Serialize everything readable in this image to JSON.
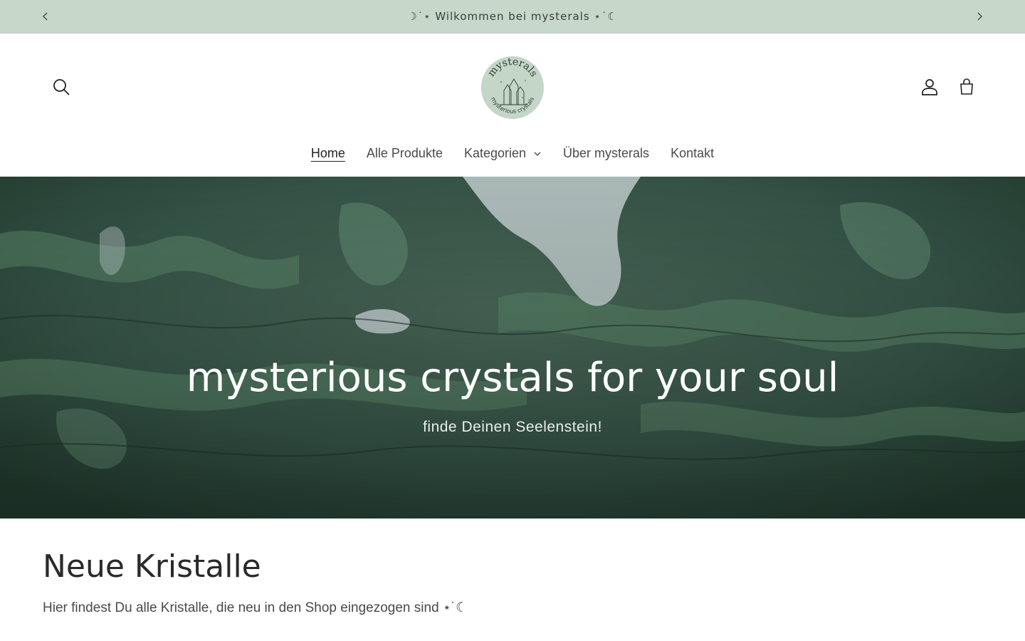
{
  "announcement": {
    "text": "☽˙⋆ Wilkommen bei mysterals ⋆˙☾"
  },
  "header": {
    "logo": {
      "title": "mysterals",
      "tagline": "mysterious crystals"
    },
    "nav": [
      {
        "label": "Home",
        "active": true
      },
      {
        "label": "Alle Produkte"
      },
      {
        "label": "Kategorien",
        "has_dropdown": true
      },
      {
        "label": "Über mysterals"
      },
      {
        "label": "Kontakt"
      }
    ],
    "icons": {
      "search": "search-icon",
      "account": "user-icon",
      "cart": "cart-icon",
      "prev": "chevron-left-icon",
      "next": "chevron-right-icon"
    }
  },
  "hero": {
    "title": "mysterious crystals for your soul",
    "subtitle": "finde Deinen Seelenstein!"
  },
  "section": {
    "title": "Neue Kristalle",
    "description": "Hier findest Du alle Kristalle, die neu in den Shop eingezogen sind ⋆˙☾"
  },
  "colors": {
    "announcement_bg": "#c7d8cb",
    "hero_base": "#34503f",
    "text": "#2b2b2b"
  }
}
